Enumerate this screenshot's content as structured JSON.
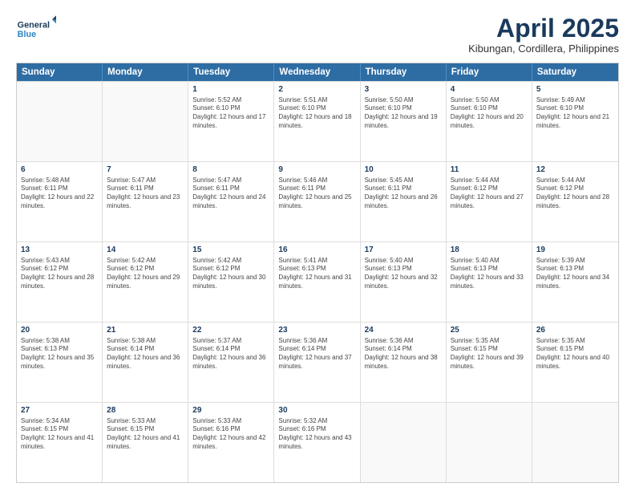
{
  "logo": {
    "line1": "General",
    "line2": "Blue"
  },
  "title": "April 2025",
  "subtitle": "Kibungan, Cordillera, Philippines",
  "headers": [
    "Sunday",
    "Monday",
    "Tuesday",
    "Wednesday",
    "Thursday",
    "Friday",
    "Saturday"
  ],
  "weeks": [
    [
      {
        "day": "",
        "info": ""
      },
      {
        "day": "",
        "info": ""
      },
      {
        "day": "1",
        "info": "Sunrise: 5:52 AM\nSunset: 6:10 PM\nDaylight: 12 hours and 17 minutes."
      },
      {
        "day": "2",
        "info": "Sunrise: 5:51 AM\nSunset: 6:10 PM\nDaylight: 12 hours and 18 minutes."
      },
      {
        "day": "3",
        "info": "Sunrise: 5:50 AM\nSunset: 6:10 PM\nDaylight: 12 hours and 19 minutes."
      },
      {
        "day": "4",
        "info": "Sunrise: 5:50 AM\nSunset: 6:10 PM\nDaylight: 12 hours and 20 minutes."
      },
      {
        "day": "5",
        "info": "Sunrise: 5:49 AM\nSunset: 6:10 PM\nDaylight: 12 hours and 21 minutes."
      }
    ],
    [
      {
        "day": "6",
        "info": "Sunrise: 5:48 AM\nSunset: 6:11 PM\nDaylight: 12 hours and 22 minutes."
      },
      {
        "day": "7",
        "info": "Sunrise: 5:47 AM\nSunset: 6:11 PM\nDaylight: 12 hours and 23 minutes."
      },
      {
        "day": "8",
        "info": "Sunrise: 5:47 AM\nSunset: 6:11 PM\nDaylight: 12 hours and 24 minutes."
      },
      {
        "day": "9",
        "info": "Sunrise: 5:46 AM\nSunset: 6:11 PM\nDaylight: 12 hours and 25 minutes."
      },
      {
        "day": "10",
        "info": "Sunrise: 5:45 AM\nSunset: 6:11 PM\nDaylight: 12 hours and 26 minutes."
      },
      {
        "day": "11",
        "info": "Sunrise: 5:44 AM\nSunset: 6:12 PM\nDaylight: 12 hours and 27 minutes."
      },
      {
        "day": "12",
        "info": "Sunrise: 5:44 AM\nSunset: 6:12 PM\nDaylight: 12 hours and 28 minutes."
      }
    ],
    [
      {
        "day": "13",
        "info": "Sunrise: 5:43 AM\nSunset: 6:12 PM\nDaylight: 12 hours and 28 minutes."
      },
      {
        "day": "14",
        "info": "Sunrise: 5:42 AM\nSunset: 6:12 PM\nDaylight: 12 hours and 29 minutes."
      },
      {
        "day": "15",
        "info": "Sunrise: 5:42 AM\nSunset: 6:12 PM\nDaylight: 12 hours and 30 minutes."
      },
      {
        "day": "16",
        "info": "Sunrise: 5:41 AM\nSunset: 6:13 PM\nDaylight: 12 hours and 31 minutes."
      },
      {
        "day": "17",
        "info": "Sunrise: 5:40 AM\nSunset: 6:13 PM\nDaylight: 12 hours and 32 minutes."
      },
      {
        "day": "18",
        "info": "Sunrise: 5:40 AM\nSunset: 6:13 PM\nDaylight: 12 hours and 33 minutes."
      },
      {
        "day": "19",
        "info": "Sunrise: 5:39 AM\nSunset: 6:13 PM\nDaylight: 12 hours and 34 minutes."
      }
    ],
    [
      {
        "day": "20",
        "info": "Sunrise: 5:38 AM\nSunset: 6:13 PM\nDaylight: 12 hours and 35 minutes."
      },
      {
        "day": "21",
        "info": "Sunrise: 5:38 AM\nSunset: 6:14 PM\nDaylight: 12 hours and 36 minutes."
      },
      {
        "day": "22",
        "info": "Sunrise: 5:37 AM\nSunset: 6:14 PM\nDaylight: 12 hours and 36 minutes."
      },
      {
        "day": "23",
        "info": "Sunrise: 5:36 AM\nSunset: 6:14 PM\nDaylight: 12 hours and 37 minutes."
      },
      {
        "day": "24",
        "info": "Sunrise: 5:36 AM\nSunset: 6:14 PM\nDaylight: 12 hours and 38 minutes."
      },
      {
        "day": "25",
        "info": "Sunrise: 5:35 AM\nSunset: 6:15 PM\nDaylight: 12 hours and 39 minutes."
      },
      {
        "day": "26",
        "info": "Sunrise: 5:35 AM\nSunset: 6:15 PM\nDaylight: 12 hours and 40 minutes."
      }
    ],
    [
      {
        "day": "27",
        "info": "Sunrise: 5:34 AM\nSunset: 6:15 PM\nDaylight: 12 hours and 41 minutes."
      },
      {
        "day": "28",
        "info": "Sunrise: 5:33 AM\nSunset: 6:15 PM\nDaylight: 12 hours and 41 minutes."
      },
      {
        "day": "29",
        "info": "Sunrise: 5:33 AM\nSunset: 6:16 PM\nDaylight: 12 hours and 42 minutes."
      },
      {
        "day": "30",
        "info": "Sunrise: 5:32 AM\nSunset: 6:16 PM\nDaylight: 12 hours and 43 minutes."
      },
      {
        "day": "",
        "info": ""
      },
      {
        "day": "",
        "info": ""
      },
      {
        "day": "",
        "info": ""
      }
    ]
  ]
}
